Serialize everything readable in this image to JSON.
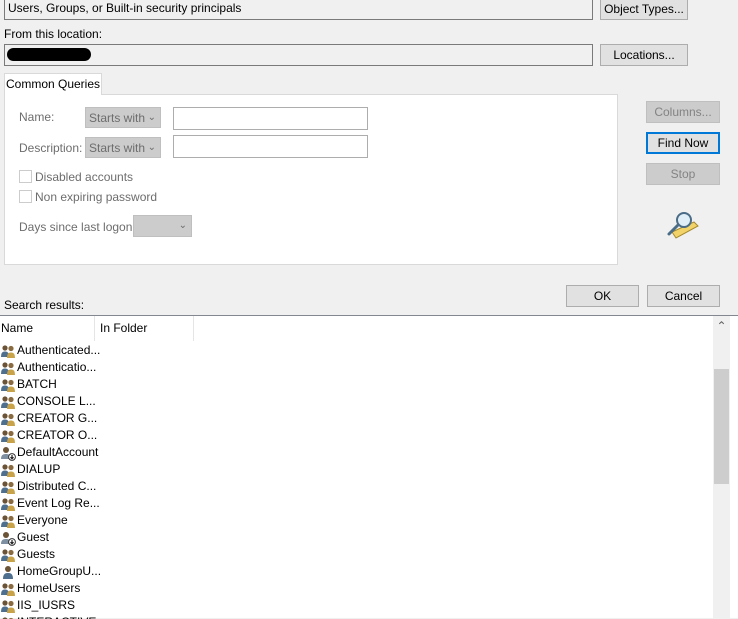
{
  "object_type": {
    "value": "Users, Groups, or Built-in security principals",
    "button": "Object Types..."
  },
  "location": {
    "label": "From this location:",
    "button": "Locations..."
  },
  "common_queries": {
    "tab": "Common Queries",
    "name_label": "Name:",
    "name_mode": "Starts with",
    "description_label": "Description:",
    "description_mode": "Starts with",
    "disabled_accounts": "Disabled accounts",
    "non_expiring_password": "Non expiring password",
    "days_since_logon_label": "Days since last logon:"
  },
  "side_buttons": {
    "columns": "Columns...",
    "find_now": "Find Now",
    "stop": "Stop"
  },
  "dialog_buttons": {
    "ok": "OK",
    "cancel": "Cancel"
  },
  "search_results": {
    "label": "Search results:",
    "columns": [
      "Name",
      "In Folder"
    ],
    "rows": [
      {
        "name": "Authenticated...",
        "icon": "group-icon"
      },
      {
        "name": "Authenticatio...",
        "icon": "group-icon"
      },
      {
        "name": "BATCH",
        "icon": "group-icon"
      },
      {
        "name": "CONSOLE L...",
        "icon": "group-icon"
      },
      {
        "name": "CREATOR G...",
        "icon": "group-icon"
      },
      {
        "name": "CREATOR O...",
        "icon": "group-icon"
      },
      {
        "name": "DefaultAccount",
        "icon": "disabled-user-icon"
      },
      {
        "name": "DIALUP",
        "icon": "group-icon"
      },
      {
        "name": "Distributed C...",
        "icon": "group-icon"
      },
      {
        "name": "Event Log Re...",
        "icon": "group-icon"
      },
      {
        "name": "Everyone",
        "icon": "group-icon"
      },
      {
        "name": "Guest",
        "icon": "disabled-user-icon"
      },
      {
        "name": "Guests",
        "icon": "group-icon"
      },
      {
        "name": "HomeGroupU...",
        "icon": "user-icon"
      },
      {
        "name": "HomeUsers",
        "icon": "group-icon"
      },
      {
        "name": "IIS_IUSRS",
        "icon": "group-icon"
      },
      {
        "name": "INTERACTIVE",
        "icon": "group-icon"
      }
    ]
  }
}
